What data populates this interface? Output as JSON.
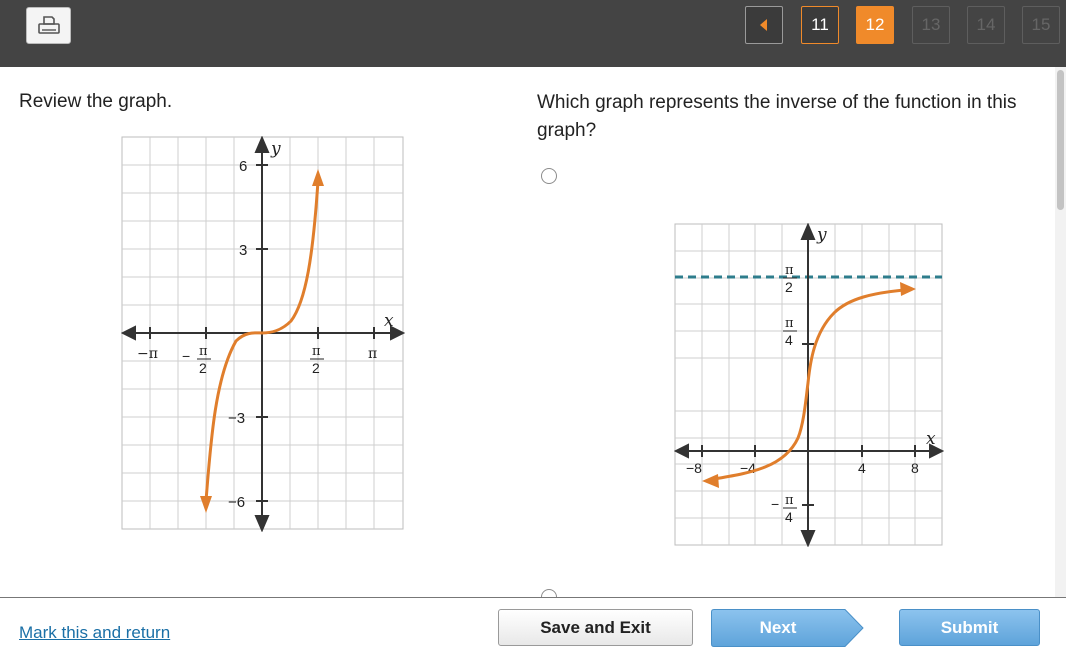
{
  "toolbar": {
    "print_icon": "print-icon",
    "prev_icon": "triangle-left-icon",
    "questions": [
      "11",
      "12",
      "13",
      "14",
      "15"
    ],
    "current_question": "12",
    "accent": "#f08a2a"
  },
  "left": {
    "review_label": "Review the graph.",
    "graph": {
      "x_axis_label": "x",
      "y_axis_label": "y",
      "x_ticks": [
        "−π",
        "π",
        "2",
        "π",
        "2",
        "π"
      ],
      "x_tick_minus_sign": "−",
      "y_ticks": [
        "6",
        "3",
        "−3",
        "−6"
      ],
      "curve_color": "#e07e2c"
    }
  },
  "right": {
    "question_text": "Which graph represents the inverse of the function in this graph?",
    "option_a": {
      "graph": {
        "x_axis_label": "x",
        "y_axis_label": "y",
        "x_ticks": [
          "−8",
          "−4",
          "4",
          "8"
        ],
        "y_ticks": [
          "π",
          "2",
          "π",
          "4",
          "π",
          "4",
          "π",
          "2"
        ],
        "y_tick_minus_sign": "−",
        "asymptote_color": "#2e7d8c",
        "curve_color": "#e07e2c"
      }
    }
  },
  "footer": {
    "mark_link": "Mark this and return",
    "save_exit": "Save and Exit",
    "next": "Next",
    "submit": "Submit",
    "button_color": "#5ea3da"
  }
}
